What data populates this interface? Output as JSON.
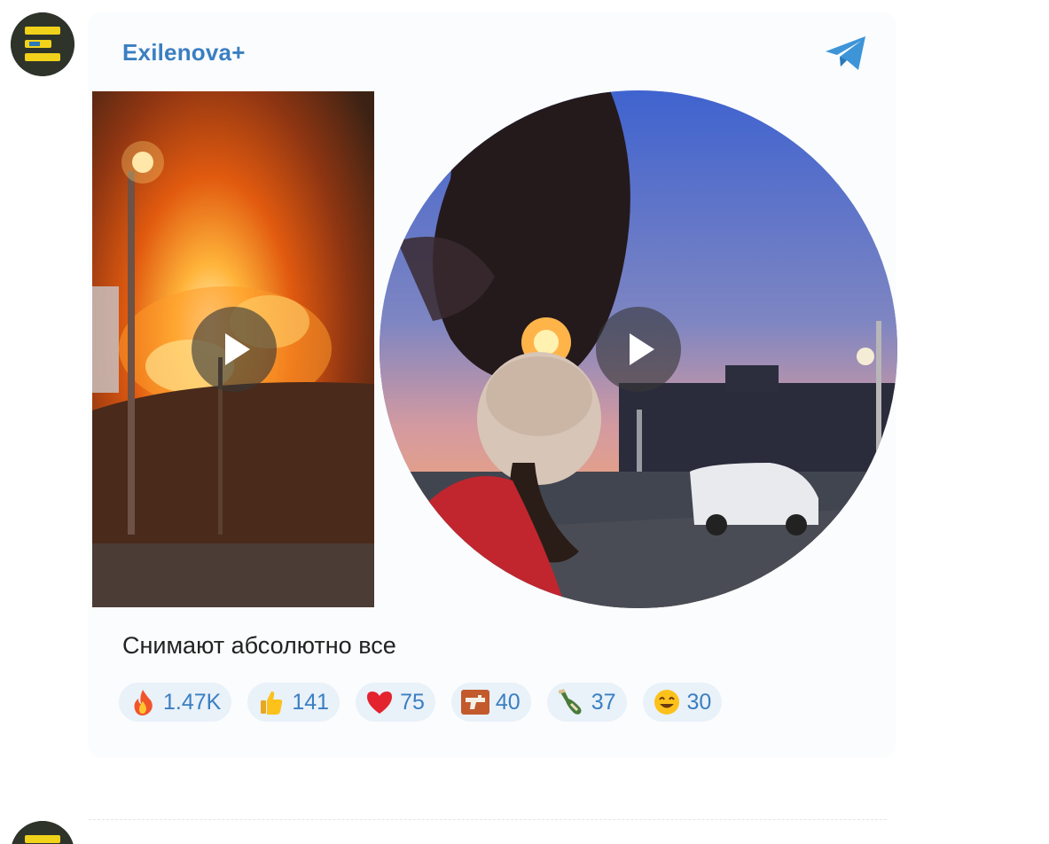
{
  "post": {
    "channel_name": "Exilenova+",
    "caption": "Снимают абсолютно все",
    "share_icon": "telegram-plane-icon",
    "media": [
      {
        "kind": "video",
        "icon": "play-icon"
      },
      {
        "kind": "round-video",
        "icon": "play-icon"
      }
    ],
    "reactions": [
      {
        "icon": "fire-emoji-icon",
        "count": "1.47K"
      },
      {
        "icon": "thumbs-up-emoji-icon",
        "count": "141"
      },
      {
        "icon": "red-heart-emoji-icon",
        "count": "75"
      },
      {
        "icon": "pistol-emoji-icon",
        "count": "40"
      },
      {
        "icon": "bottle-emoji-icon",
        "count": "37"
      },
      {
        "icon": "laughing-face-emoji-icon",
        "count": "30"
      }
    ]
  },
  "colors": {
    "accent": "#3a7fc2",
    "reaction_bg": "#e9f1f9",
    "avatar_bg": "#2e342a",
    "avatar_logo": "#f1d21b"
  }
}
